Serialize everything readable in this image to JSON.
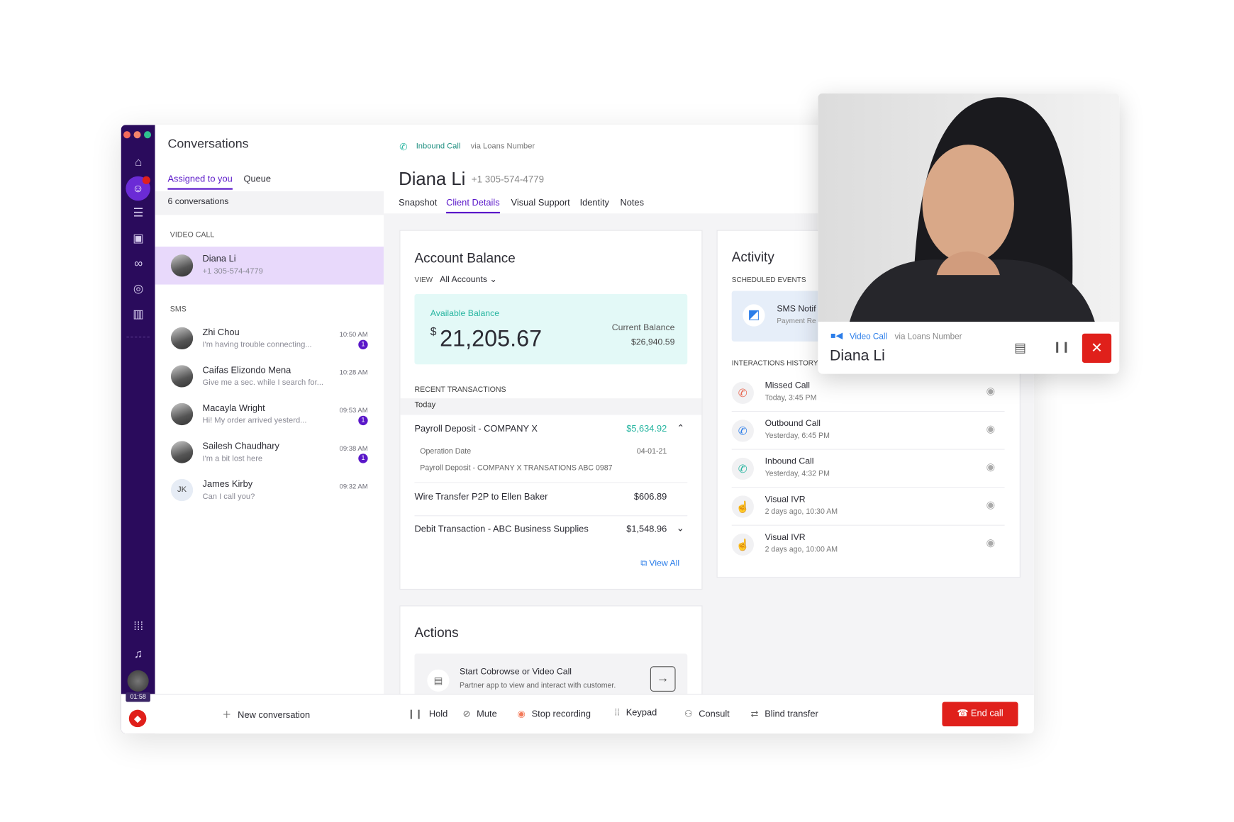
{
  "colors": {
    "rail": "#2a0b5c",
    "accent": "#5a17c9",
    "selected": "#e8d9fb",
    "teal": "#26b5a0",
    "balance_bg": "#e3f9f7",
    "danger": "#e0201b",
    "link": "#2b7de9"
  },
  "rail_icons": [
    "home-icon",
    "conversations-icon",
    "list-icon",
    "contacts-icon",
    "voicemail-icon",
    "agent-icon",
    "book-icon",
    "apps-grid-icon",
    "bell-icon"
  ],
  "rail_timer": "01:58",
  "conversations": {
    "title": "Conversations",
    "tabs": [
      "Assigned to you",
      "Queue"
    ],
    "count": "6 conversations",
    "video_section": "VIDEO CALL",
    "video_item": {
      "name": "Diana Li",
      "phone": "+1 305-574-4779"
    },
    "sms_section": "SMS",
    "sms": [
      {
        "name": "Zhi Chou",
        "preview": "I'm having trouble connecting...",
        "time": "10:50 AM",
        "badge": "1"
      },
      {
        "name": "Caifas Elizondo Mena",
        "preview": "Give me a sec. while I search for...",
        "time": "10:28 AM",
        "badge": ""
      },
      {
        "name": "Macayla Wright",
        "preview": "Hi! My order arrived yesterd...",
        "time": "09:53 AM",
        "badge": "1"
      },
      {
        "name": "Sailesh Chaudhary",
        "preview": "I'm a bit lost here",
        "time": "09:38 AM",
        "badge": "1"
      },
      {
        "name": "James Kirby",
        "preview": "Can I call you?",
        "time": "09:32 AM",
        "badge": "",
        "initials": "JK"
      }
    ],
    "new_conversation": "New conversation"
  },
  "header": {
    "call_type": "Inbound Call",
    "via": "via Loans Number",
    "name": "Diana Li",
    "phone": "+1 305-574-4779",
    "tabs": [
      "Snapshot",
      "Client Details",
      "Visual Support",
      "Identity",
      "Notes"
    ],
    "active_tab": "Client Details"
  },
  "account": {
    "title": "Account Balance",
    "view_label": "VIEW",
    "view_value": "All Accounts",
    "available_label": "Available Balance",
    "available_currency": "$",
    "available_value": "21,205.67",
    "current_label": "Current Balance",
    "current_value": "$26,940.59",
    "recent_label": "RECENT TRANSACTIONS",
    "day": "Today",
    "tx": [
      {
        "name": "Payroll Deposit - COMPANY X",
        "amount": "$5,634.92",
        "detail_label": "Operation Date",
        "detail_date": "04-01-21",
        "detail_desc": "Payroll Deposit - COMPANY X TRANSATIONS ABC 0987"
      },
      {
        "name": "Wire Transfer P2P to Ellen Baker",
        "amount": "$606.89"
      },
      {
        "name": "Debit Transaction - ABC Business Supplies",
        "amount": "$1,548.96"
      }
    ],
    "view_all": "View All"
  },
  "actions": {
    "title": "Actions",
    "item_title": "Start Cobrowse or Video Call",
    "item_desc": "Partner app to view and interact with customer."
  },
  "activity": {
    "title": "Activity",
    "scheduled_label": "SCHEDULED EVENTS",
    "scheduled_title": "SMS Notif",
    "scheduled_sub": "Payment Re",
    "history_label": "INTERACTIONS HISTORY",
    "history": [
      {
        "title": "Missed Call",
        "time": "Today, 3:45 PM",
        "icon": "missed-call-icon"
      },
      {
        "title": "Outbound Call",
        "time": "Yesterday, 6:45 PM",
        "icon": "outbound-call-icon"
      },
      {
        "title": "Inbound Call",
        "time": "Yesterday, 4:32 PM",
        "icon": "inbound-call-icon"
      },
      {
        "title": "Visual IVR",
        "time": "2 days ago, 10:30 AM",
        "icon": "visual-ivr-icon"
      },
      {
        "title": "Visual IVR",
        "time": "2 days ago, 10:00 AM",
        "icon": "visual-ivr-icon"
      }
    ]
  },
  "callbar": {
    "hold": "Hold",
    "mute": "Mute",
    "stop_recording": "Stop recording",
    "keypad": "Keypad",
    "consult": "Consult",
    "blind_transfer": "Blind transfer",
    "end_call": "End call"
  },
  "video": {
    "type": "Video Call",
    "via": "via Loans Number",
    "name": "Diana Li"
  }
}
